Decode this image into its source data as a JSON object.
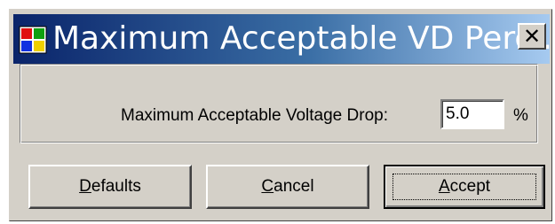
{
  "window": {
    "title": "Maximum Acceptable VD Perc...",
    "close_glyph": "✕",
    "icon": "app-window-icon"
  },
  "form": {
    "label": "Maximum Acceptable Voltage Drop:",
    "value": "5.0",
    "unit": "%"
  },
  "buttons": {
    "defaults": {
      "mnemonic": "D",
      "rest": "efaults"
    },
    "cancel": {
      "mnemonic": "C",
      "rest": "ancel"
    },
    "accept": {
      "mnemonic": "A",
      "rest": "ccept"
    }
  },
  "colors": {
    "titlebar_start": "#0a246a",
    "titlebar_end": "#a6caf0",
    "face": "#d4d0c8"
  }
}
